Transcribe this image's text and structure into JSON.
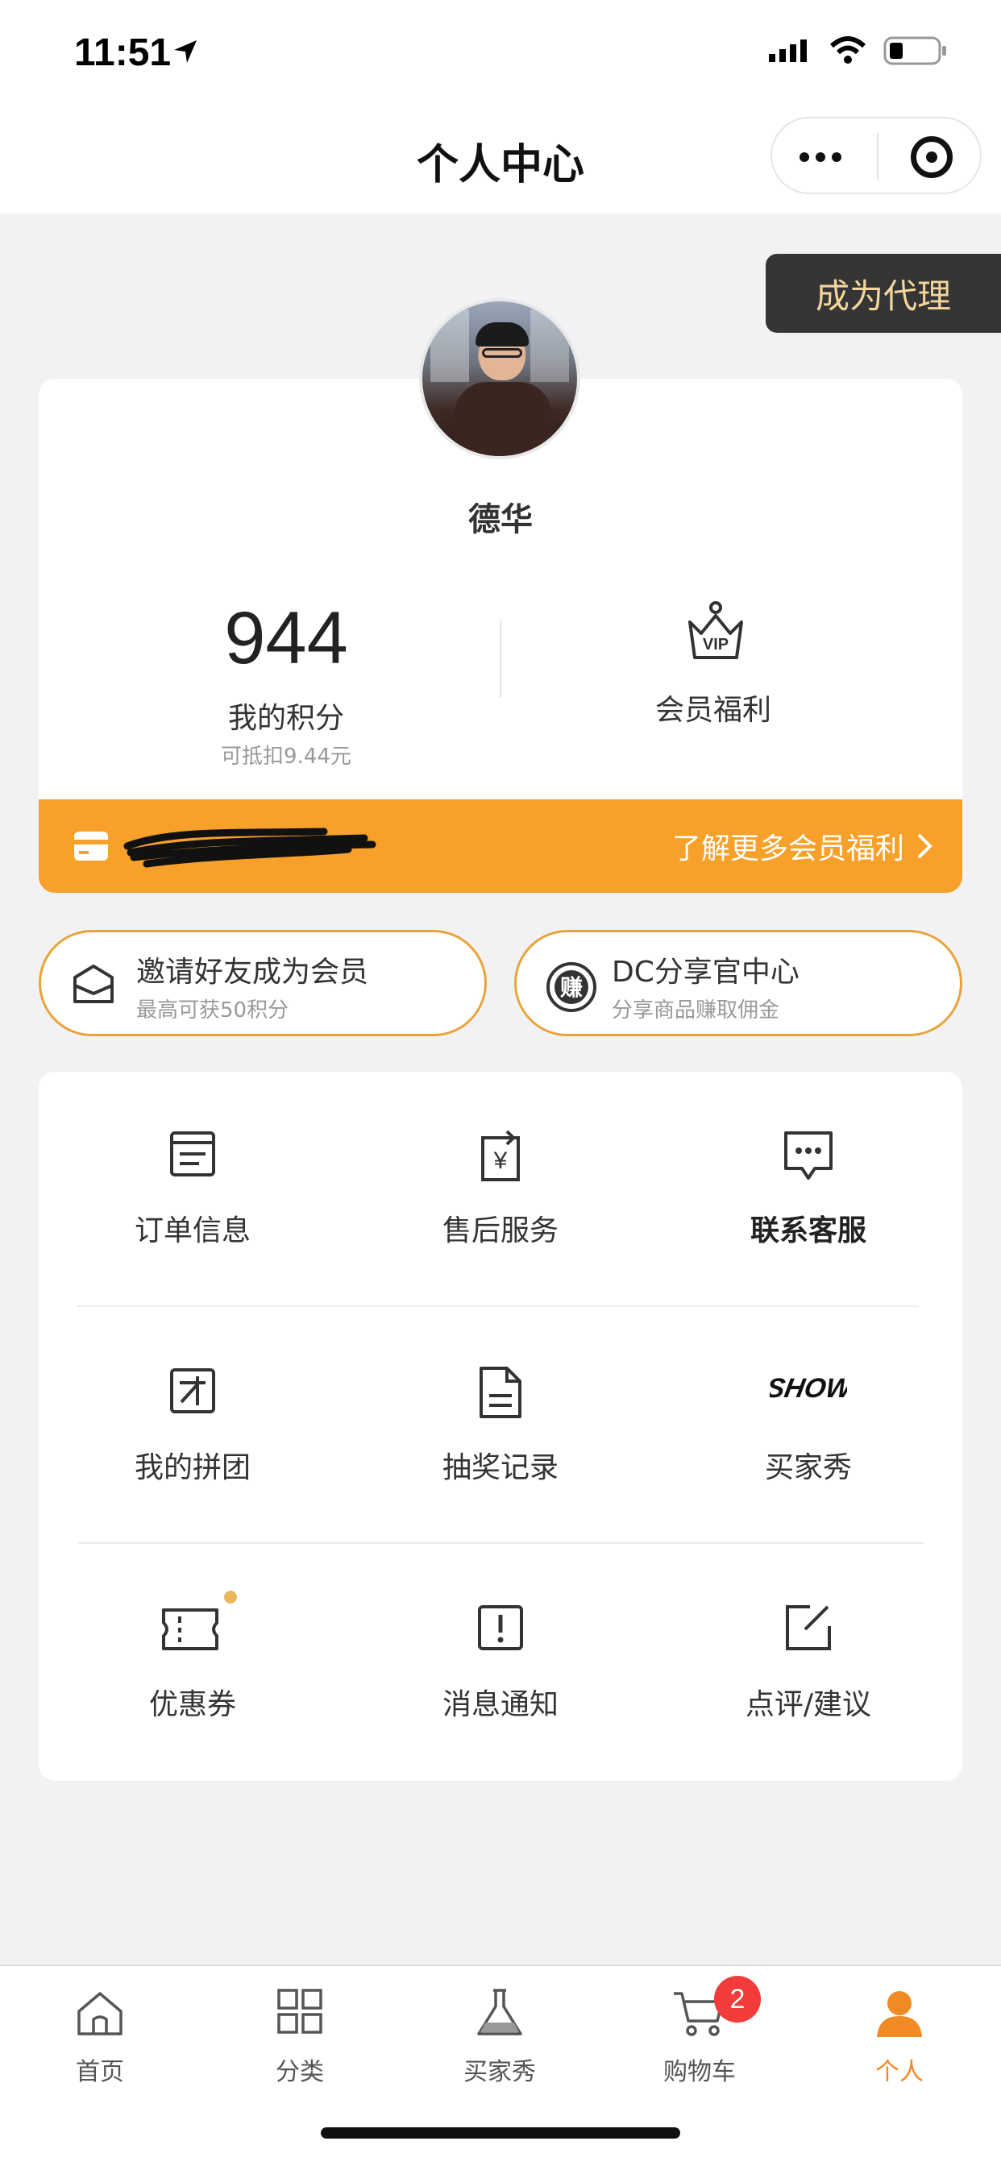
{
  "status": {
    "time": "11:51"
  },
  "nav": {
    "title": "个人中心"
  },
  "agent": {
    "label": "成为代理"
  },
  "profile": {
    "name": "德华",
    "points_value": "944",
    "points_label": "我的积分",
    "points_sub": "可抵扣9.44元",
    "vip_label": "会员福利"
  },
  "member_bar": {
    "link": "了解更多会员福利"
  },
  "pills": [
    {
      "title": "邀请好友成为会员",
      "sub": "最高可获50积分",
      "icon": "envelope-icon"
    },
    {
      "title": "DC分享官中心",
      "sub": "分享商品赚取佣金",
      "icon": "earn-icon",
      "icon_char": "赚"
    }
  ],
  "grid": [
    {
      "label": "订单信息",
      "icon": "order-list-icon"
    },
    {
      "label": "售后服务",
      "icon": "after-sales-icon"
    },
    {
      "label": "联系客服",
      "icon": "chat-bubble-icon"
    },
    {
      "label": "我的拼团",
      "icon": "group-buy-icon"
    },
    {
      "label": "抽奖记录",
      "icon": "document-icon"
    },
    {
      "label": "买家秀",
      "icon": "show-icon",
      "icon_text": "SHOW"
    },
    {
      "label": "优惠券",
      "icon": "coupon-icon"
    },
    {
      "label": "消息通知",
      "icon": "alert-box-icon"
    },
    {
      "label": "点评/建议",
      "icon": "edit-icon"
    }
  ],
  "tabs": [
    {
      "label": "首页",
      "icon": "home-icon"
    },
    {
      "label": "分类",
      "icon": "grid-icon"
    },
    {
      "label": "买家秀",
      "icon": "flask-icon"
    },
    {
      "label": "购物车",
      "icon": "cart-icon",
      "badge": "2"
    },
    {
      "label": "个人",
      "icon": "person-icon",
      "active": true
    }
  ],
  "colors": {
    "accent": "#f7a12a",
    "active_tab": "#f08a24",
    "agent_bg": "#353535",
    "agent_text": "#f4d69d",
    "badge": "#f23b3b"
  }
}
